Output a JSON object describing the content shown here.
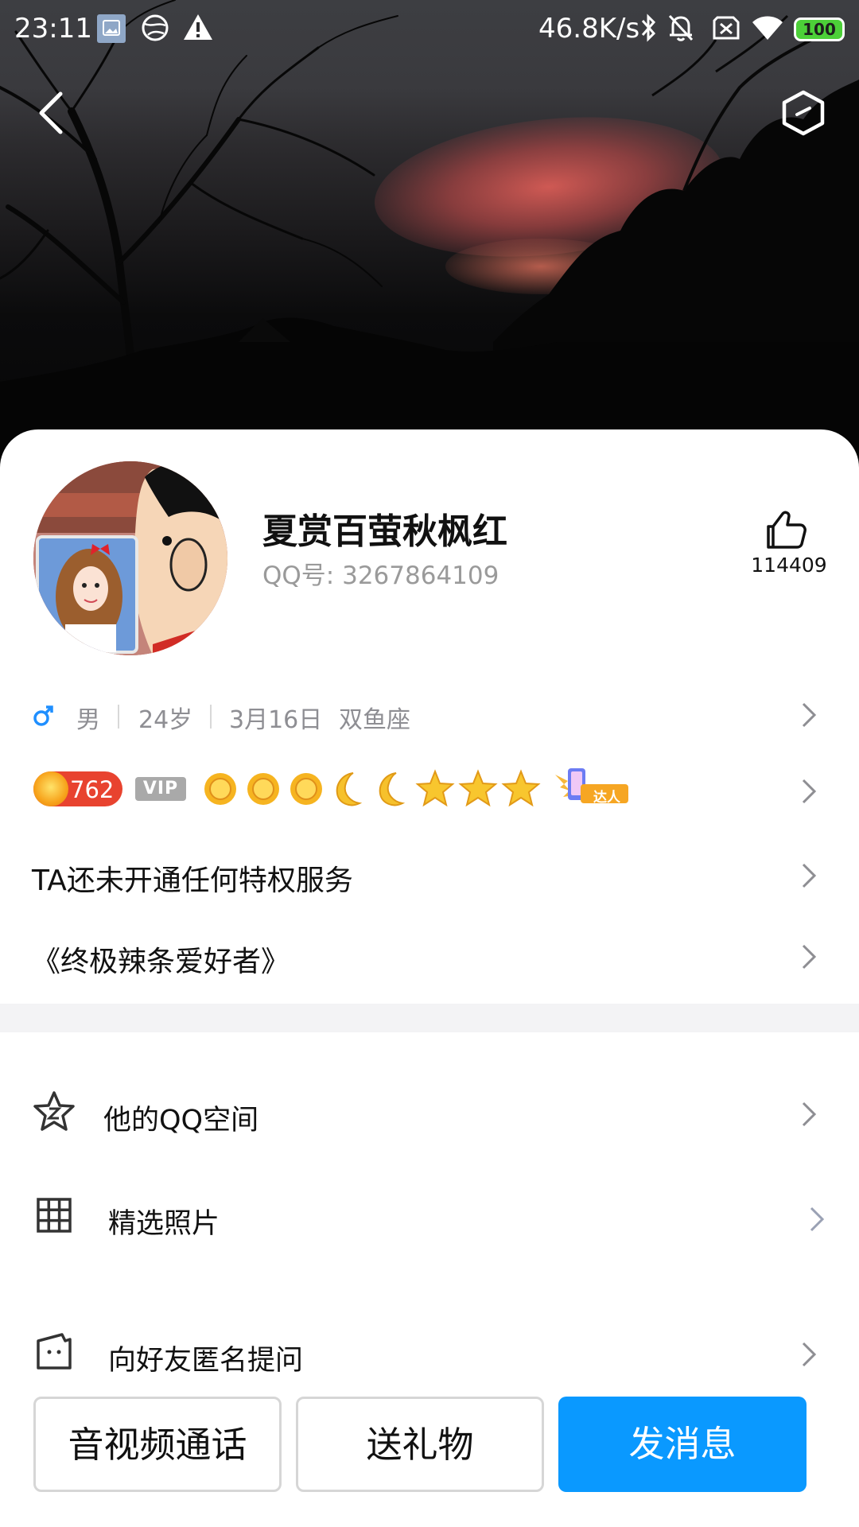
{
  "status_bar": {
    "time": "23:11",
    "net_speed": "46.8K/s",
    "battery": "100",
    "icons": [
      "gallery-icon",
      "vpn-icon",
      "warning-icon",
      "bluetooth-icon",
      "mute-icon",
      "sim-icon",
      "wifi-icon",
      "battery-icon"
    ]
  },
  "header": {
    "back_icon": "chevron-left-icon",
    "settings_icon": "hexagon-settings-icon"
  },
  "profile": {
    "nickname": "夏赏百萤秋枫红",
    "qq_id": "QQ号: 3267864109",
    "like_count": "114409",
    "gender": "男",
    "age": "24岁",
    "birthday": "3月16日",
    "zodiac": "双鱼座"
  },
  "levels": {
    "points": "762",
    "vip_label": "VIP",
    "icons": [
      "sun-icon",
      "sun-icon",
      "sun-icon",
      "moon-icon",
      "moon-icon",
      "star-icon",
      "star-icon",
      "star-icon"
    ],
    "badge_label": "达人"
  },
  "rows": {
    "privilege": "TA还未开通任何特权服务",
    "signature": "《终极辣条爱好者》"
  },
  "menu": [
    {
      "label": "他的QQ空间",
      "icon": "qzone-star-icon"
    },
    {
      "label": "精选照片",
      "icon": "grid-icon"
    },
    {
      "label": "向好友匿名提问",
      "icon": "question-bag-icon"
    }
  ],
  "actions": {
    "call": "音视频通话",
    "gift": "送礼物",
    "message": "发消息"
  },
  "colors": {
    "primary": "#0a99ff",
    "gender_male": "#1f8fff",
    "points_pill": "#e8432f",
    "vip_badge": "#a9a9a9"
  }
}
